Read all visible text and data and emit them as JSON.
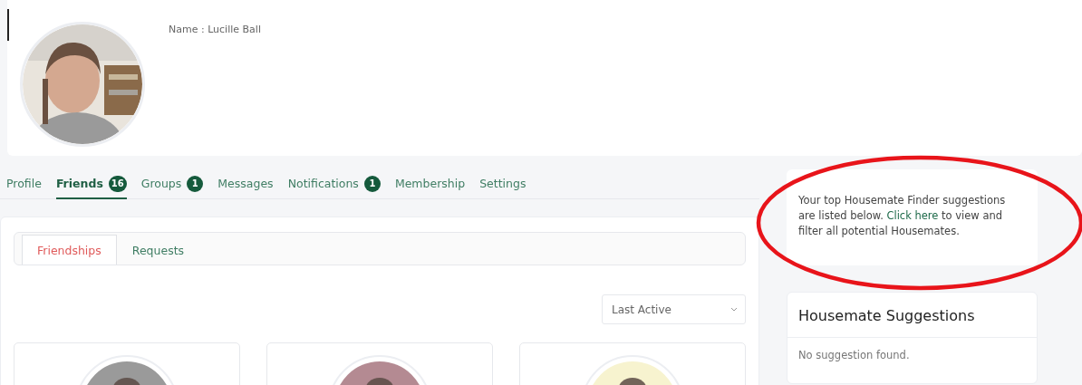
{
  "profile": {
    "name_label": "Name : Lucille Ball"
  },
  "tabs": [
    {
      "label": "Profile",
      "selected": false
    },
    {
      "label": "Friends",
      "badge": "16",
      "selected": true
    },
    {
      "label": "Groups",
      "badge": "1",
      "selected": false
    },
    {
      "label": "Messages",
      "selected": false
    },
    {
      "label": "Notifications",
      "badge": "1",
      "selected": false
    },
    {
      "label": "Membership",
      "selected": false
    },
    {
      "label": "Settings",
      "selected": false
    }
  ],
  "subtabs": [
    {
      "label": "Friendships",
      "selected": true
    },
    {
      "label": "Requests",
      "selected": false
    }
  ],
  "sort_select": {
    "value": "Last Active"
  },
  "friend_cards": [
    {
      "color": "#9a9a9a"
    },
    {
      "color": "#b48a92"
    },
    {
      "color": "#f7f3cf"
    }
  ],
  "finder_note": {
    "before": "Your top Housemate Finder suggestions are listed below. ",
    "link": "Click here",
    "after": " to view and filter all potential Housemates."
  },
  "suggestions": {
    "title": "Housemate Suggestions",
    "empty": "No suggestion found."
  }
}
